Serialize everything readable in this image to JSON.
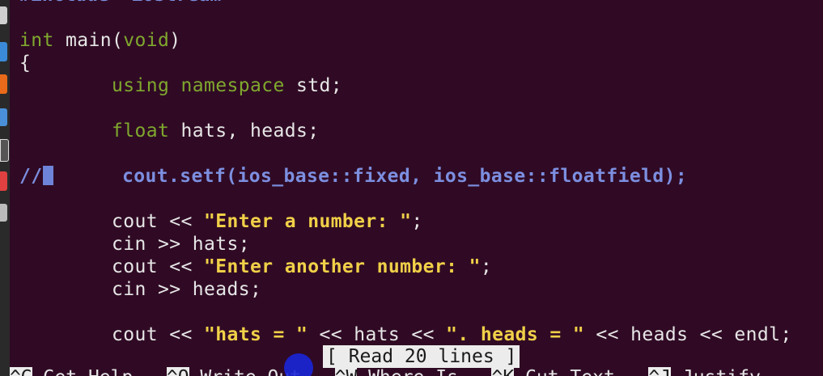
{
  "editor": {
    "top_partial": "#include <iostream>",
    "lines": [
      {
        "segments": [
          [
            "int",
            "kw-green"
          ],
          [
            " main(",
            ""
          ],
          [
            "void",
            "kw-green"
          ],
          [
            ")",
            ""
          ]
        ]
      },
      {
        "segments": [
          [
            "{",
            ""
          ]
        ]
      },
      {
        "segments": [
          [
            "        ",
            ""
          ],
          [
            "using",
            "kw-green"
          ],
          [
            " ",
            ""
          ],
          [
            "namespace",
            "kw-green"
          ],
          [
            " std;",
            ""
          ]
        ]
      },
      {
        "segments": []
      },
      {
        "segments": [
          [
            "        ",
            ""
          ],
          [
            "float",
            "kw-green"
          ],
          [
            " hats, heads;",
            ""
          ]
        ]
      },
      {
        "segments": []
      },
      {
        "segments": [
          [
            "//",
            "comment"
          ],
          [
            "CURSOR",
            "cursor"
          ],
          [
            "      cout.setf(ios_base::fixed, ios_base::floatfield);",
            "comment"
          ]
        ]
      },
      {
        "segments": []
      },
      {
        "segments": [
          [
            "        cout << ",
            ""
          ],
          [
            "\"Enter a number: \"",
            "str"
          ],
          [
            ";",
            ""
          ]
        ]
      },
      {
        "segments": [
          [
            "        cin >> hats;",
            ""
          ]
        ]
      },
      {
        "segments": [
          [
            "        cout << ",
            ""
          ],
          [
            "\"Enter another number: \"",
            "str"
          ],
          [
            ";",
            ""
          ]
        ]
      },
      {
        "segments": [
          [
            "        cin >> heads;",
            ""
          ]
        ]
      },
      {
        "segments": []
      },
      {
        "segments": [
          [
            "        cout << ",
            ""
          ],
          [
            "\"hats = \"",
            "str"
          ],
          [
            " << hats << ",
            ""
          ],
          [
            "\". heads = \"",
            "str"
          ],
          [
            " << heads << endl;",
            ""
          ]
        ]
      }
    ]
  },
  "status_message": "[ Read 20 lines ]",
  "shortcuts": [
    {
      "key": "^G",
      "label": "Get Help"
    },
    {
      "key": "^O",
      "label": "Write Out"
    },
    {
      "key": "^W",
      "label": "Where Is"
    },
    {
      "key": "^K",
      "label": "Cut Text"
    },
    {
      "key": "^J",
      "label": "Justify"
    }
  ],
  "colors": {
    "background": "#300a24",
    "keyword": "#7fa82e",
    "comment": "#7c8fe0",
    "string": "#f0d048",
    "text": "#e6e6e6",
    "click_indicator": "#1a25d8"
  },
  "launcher_icons": [
    "files-icon",
    "firefox-icon",
    "chrome-icon",
    "terminal-icon",
    "software-icon",
    "settings-icon"
  ]
}
